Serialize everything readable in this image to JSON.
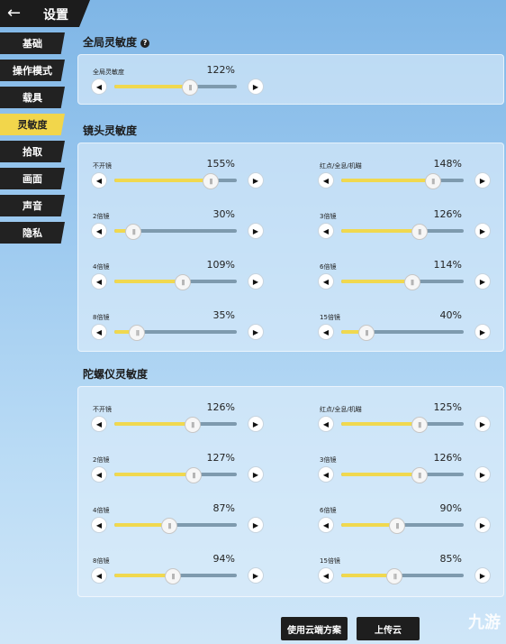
{
  "header": {
    "back_icon": "arrow-left-icon",
    "title": "设置"
  },
  "sidebar": {
    "items": [
      {
        "label": "基础"
      },
      {
        "label": "操作模式"
      },
      {
        "label": "载具"
      },
      {
        "label": "灵敏度",
        "active": true
      },
      {
        "label": "拾取"
      },
      {
        "label": "画面"
      },
      {
        "label": "声音"
      },
      {
        "label": "隐私"
      }
    ]
  },
  "sections": {
    "global": {
      "title": "全局灵敏度",
      "help_icon": "question-circle-icon",
      "slider": {
        "label": "全局灵敏度",
        "value": "122%",
        "level": 0.61
      }
    },
    "camera": {
      "title": "镜头灵敏度",
      "left": [
        {
          "label": "不开镜",
          "value": "155%",
          "level": 0.78
        },
        {
          "label": "2倍镜",
          "value": "30%",
          "level": 0.15
        },
        {
          "label": "4倍镜",
          "value": "109%",
          "level": 0.55
        },
        {
          "label": "8倍镜",
          "value": "35%",
          "level": 0.18
        }
      ],
      "right": [
        {
          "label": "红点/全息/机瞄",
          "value": "148%",
          "level": 0.74
        },
        {
          "label": "3倍镜",
          "value": "126%",
          "level": 0.63
        },
        {
          "label": "6倍镜",
          "value": "114%",
          "level": 0.57
        },
        {
          "label": "15倍镜",
          "value": "40%",
          "level": 0.2
        }
      ]
    },
    "gyro": {
      "title": "陀螺仪灵敏度",
      "left": [
        {
          "label": "不开镜",
          "value": "126%",
          "level": 0.63
        },
        {
          "label": "2倍镜",
          "value": "127%",
          "level": 0.64
        },
        {
          "label": "4倍镜",
          "value": "87%",
          "level": 0.44
        },
        {
          "label": "8倍镜",
          "value": "94%",
          "level": 0.47
        }
      ],
      "right": [
        {
          "label": "红点/全息/机瞄",
          "value": "125%",
          "level": 0.63
        },
        {
          "label": "3倍镜",
          "value": "126%",
          "level": 0.63
        },
        {
          "label": "6倍镜",
          "value": "90%",
          "level": 0.45
        },
        {
          "label": "15倍镜",
          "value": "85%",
          "level": 0.43
        }
      ]
    }
  },
  "footer": {
    "use_cloud": "使用云端方案",
    "upload_cloud": "上传云",
    "watermark": "九游"
  },
  "slider_buttons": {
    "decrease_icon": "triangle-left-icon",
    "increase_icon": "triangle-right-icon"
  }
}
